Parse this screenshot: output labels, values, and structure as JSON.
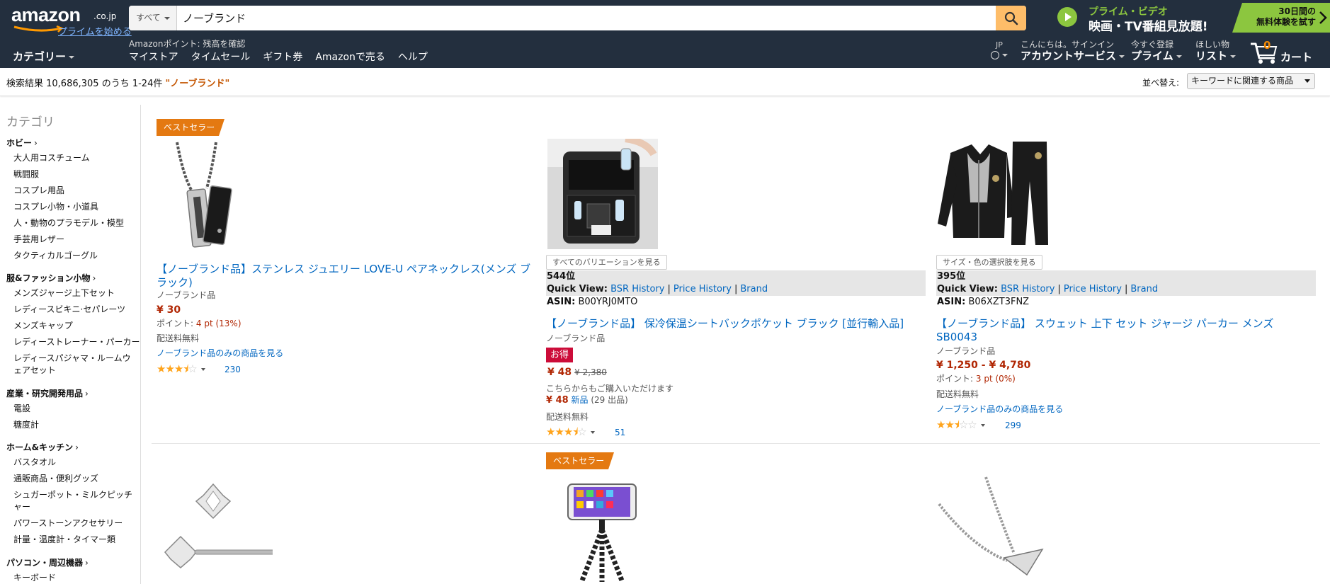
{
  "header": {
    "logo_text": "amazon",
    "logo_tld": ".co.jp",
    "prime_link": "プライムを始める",
    "search": {
      "category": "すべて",
      "query": "ノーブランド"
    },
    "prime_video": {
      "line1": "プライム・ビデオ",
      "line2": "映画・TV番組見放題!"
    },
    "free_trial": {
      "line1": "30日間の",
      "line2": "無料体験を試す"
    },
    "category_menu": "カテゴリー",
    "points_note": "Amazonポイント: 残高を確認",
    "nav_links": [
      "マイストア",
      "タイムセール",
      "ギフト券",
      "Amazonで売る",
      "ヘルプ"
    ],
    "language": "JP",
    "account": {
      "small": "こんにちは。サインイン",
      "big": "アカウントサービス"
    },
    "prime": {
      "small": "今すぐ登録",
      "big": "プライム"
    },
    "wishlist": {
      "small": "ほしい物",
      "big": "リスト"
    },
    "cart": {
      "count": "0",
      "label": "カート"
    }
  },
  "results": {
    "summary": "検索結果 10,686,305 のうち 1-24件",
    "keyword": "\"ノーブランド\"",
    "sort_label": "並べ替え:",
    "sort_value": "キーワードに関連する商品"
  },
  "sidebar": {
    "title": "カテゴリ",
    "groups": [
      {
        "name": "ホビー",
        "items": [
          "大人用コスチューム",
          "戦闘服",
          "コスプレ用品",
          "コスプレ小物・小道具",
          "人・動物のプラモデル・模型",
          "手芸用レザー",
          "タクティカルゴーグル"
        ]
      },
      {
        "name": "服&ファッション小物",
        "items": [
          "メンズジャージ上下セット",
          "レディースビキニ·セパレーツ",
          "メンズキャップ",
          "レディーストレーナー・パーカー",
          "レディースパジャマ・ルームウ",
          "ェアセット"
        ]
      },
      {
        "name": "産業・研究開発用品",
        "items": [
          "電設",
          "糖度計"
        ]
      },
      {
        "name": "ホーム&キッチン",
        "items": [
          "バスタオル",
          "通販商品・便利グッズ",
          "シュガーポット・ミルクピッチ",
          "ャー",
          "パワーストーンアクセサリー",
          "計量・温度計・タイマー類"
        ]
      },
      {
        "name": "パソコン・周辺機器",
        "items": [
          "キーボード"
        ]
      }
    ]
  },
  "products": [
    {
      "badge": "ベストセラー",
      "title_line1": "【ノーブランド品】ステンレス ジュエリー LOVE-U ペアネックレス(メンズ ブ",
      "title_line2": "ラック)",
      "brand": "ノーブランド品",
      "price": "¥ 30",
      "points_label": "ポイント:",
      "points_value": "4 pt (13%)",
      "shipping": "配送料無料",
      "brand_link": "ノーブランド品のみの商品を見る",
      "rating": 3.5,
      "reviews": "230"
    },
    {
      "variation_button": "すべてのバリエーションを見る",
      "rank": "544位",
      "quick_view_label": "Quick View:",
      "links": [
        "BSR History",
        "Price History",
        "Brand"
      ],
      "asin_label": "ASIN:",
      "asin": "B00YRJ0MTO",
      "title": "【ノーブランド品】 保冷保温シートバックポケット ブラック [並行輸入品]",
      "brand": "ノーブランド品",
      "deal": "お得",
      "price": "¥ 48",
      "list_price": "¥ 2,380",
      "other_label": "こちらからもご購入いただけます",
      "other_price": "¥ 48",
      "other_new": "新品",
      "other_count": "(29 出品)",
      "shipping": "配送料無料",
      "rating": 3.5,
      "reviews": "51"
    },
    {
      "variation_button": "サイズ・色の選択肢を見る",
      "rank": "395位",
      "quick_view_label": "Quick View:",
      "links": [
        "BSR History",
        "Price History",
        "Brand"
      ],
      "asin_label": "ASIN:",
      "asin": "B06XZT3FNZ",
      "title_line1": "【ノーブランド品】 スウェット 上下 セット ジャージ パーカー メンズ",
      "title_line2": "SB0043",
      "brand": "ノーブランド品",
      "price": "¥ 1,250 - ¥ 4,780",
      "points_label": "ポイント:",
      "points_value": "3 pt (0%)",
      "shipping": "配送料無料",
      "brand_link": "ノーブランド品のみの商品を見る",
      "rating": 2.5,
      "reviews": "299"
    },
    {
      "badge": "ベストセラー"
    }
  ],
  "colors": {
    "header_bg": "#232f3e",
    "search_button": "#febd69",
    "badge": "#e47911",
    "price": "#b12704",
    "link": "#0066c0",
    "deal": "#cc0c39",
    "prime_green": "#8cc63f"
  }
}
